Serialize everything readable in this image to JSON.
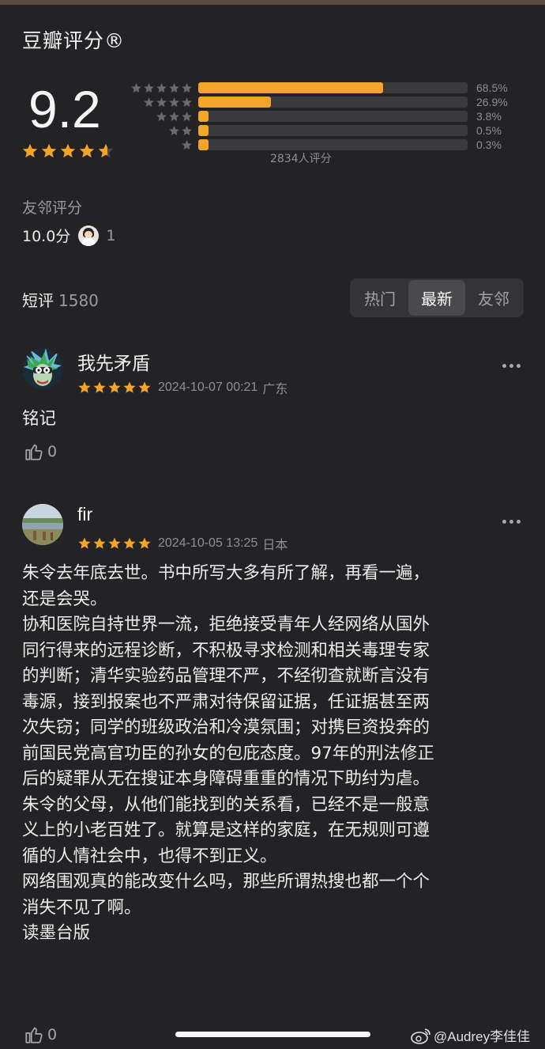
{
  "colors": {
    "background": "#232325",
    "accent": "#f2a528",
    "star": "#f2a528",
    "star_empty": "#4a4a4d"
  },
  "rating": {
    "title": "豆瓣评分®",
    "score": "9.2",
    "score_stars": 4.6,
    "distribution": [
      {
        "stars": 5,
        "percent_label": "68.5%",
        "fraction": 0.685
      },
      {
        "stars": 4,
        "percent_label": "26.9%",
        "fraction": 0.269
      },
      {
        "stars": 3,
        "percent_label": "3.8%",
        "fraction": 0.038
      },
      {
        "stars": 2,
        "percent_label": "0.5%",
        "fraction": 0.005
      },
      {
        "stars": 1,
        "percent_label": "0.3%",
        "fraction": 0.003
      }
    ],
    "raters_label": "2834人评分"
  },
  "friends": {
    "label": "友邻评分",
    "score": "10.0分",
    "count": "1"
  },
  "short_reviews": {
    "label": "短评",
    "count": "1580",
    "tabs": [
      {
        "label": "热门",
        "active": false
      },
      {
        "label": "最新",
        "active": true
      },
      {
        "label": "友邻",
        "active": false
      }
    ]
  },
  "comments": [
    {
      "name": "我先矛盾",
      "stars": 5,
      "date": "2024-10-07 00:21",
      "location": "广东",
      "text": "铭记",
      "likes": "0",
      "avatar_icon": "rick-cartoon-avatar-icon"
    },
    {
      "name": "fir",
      "stars": 5,
      "date": "2024-10-05 13:25",
      "location": "日本",
      "text": "朱令去年底去世。书中所写大多有所了解，再看一遍，\n还是会哭。\n协和医院自持世界一流，拒绝接受青年人经网络从国外\n同行得来的远程诊断，不积极寻求检测和相关毒理专家\n的判断；清华实验药品管理不严，不经彻查就断言没有\n毒源，接到报案也不严肃对待保留证据，任证据甚至两\n次失窃；同学的班级政治和冷漠氛围；对携巨资投奔的\n前国民党高官功臣的孙女的包庇态度。97年的刑法修正\n后的疑罪从无在搜证本身障碍重重的情况下助纣为虐。\n朱令的父母，从他们能找到的关系看，已经不是一般意\n义上的小老百姓了。就算是这样的家庭，在无规则可遵\n循的人情社会中，也得不到正义。\n网络围观真的能改变什么吗，那些所谓热搜也都一个个\n消失不见了啊。\n读墨台版",
      "likes": "0",
      "avatar_icon": "landscape-photo-avatar-icon"
    }
  ],
  "watermark": "@Audrey李佳佳"
}
